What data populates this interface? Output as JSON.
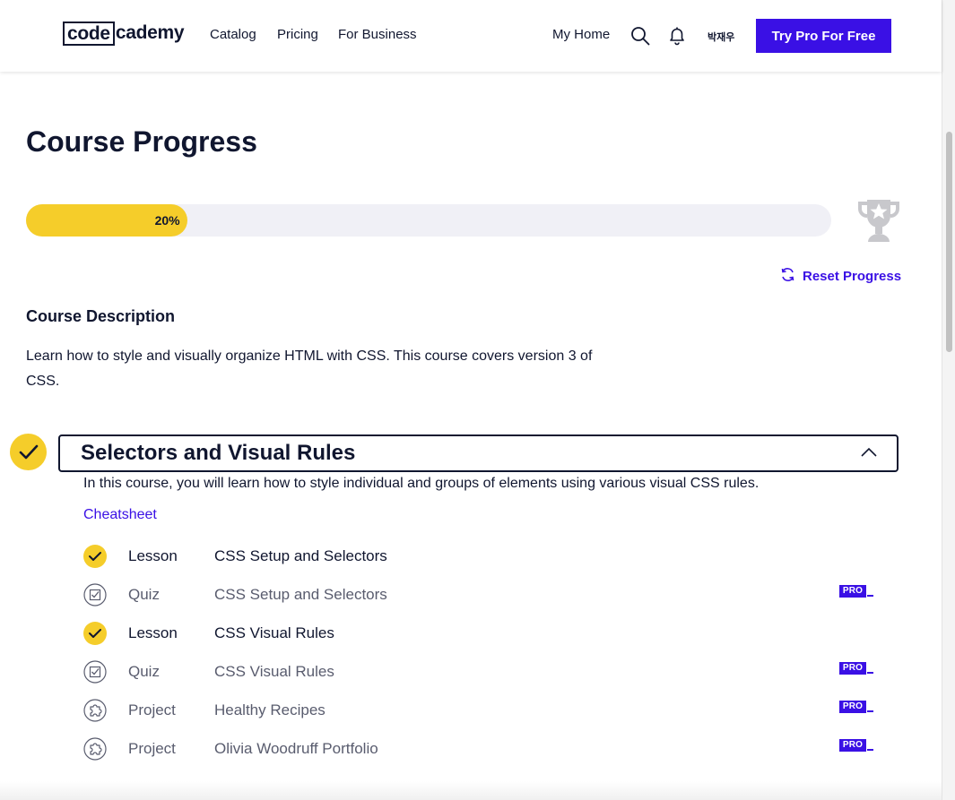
{
  "header": {
    "logo_box_text": "code",
    "logo_rest_text": "cademy",
    "nav": [
      "Catalog",
      "Pricing",
      "For Business"
    ],
    "my_home": "My Home",
    "user_name": "박재우",
    "cta_label": "Try Pro For Free"
  },
  "page": {
    "title": "Course Progress",
    "progress_percent": 20,
    "progress_label": "20%",
    "reset_label": "Reset Progress",
    "description_heading": "Course Description",
    "description_text": "Learn how to style and visually organize HTML with CSS. This course covers version 3 of CSS."
  },
  "module": {
    "title": "Selectors and Visual Rules",
    "description": "In this course, you will learn how to style individual and groups of elements using various visual CSS rules.",
    "cheatsheet_label": "Cheatsheet",
    "pro_label": "PRO",
    "items": [
      {
        "type": "Lesson",
        "name": "CSS Setup and Selectors",
        "status": "completed",
        "icon": "checkmark-icon",
        "pro": false
      },
      {
        "type": "Quiz",
        "name": "CSS Setup and Selectors",
        "status": "not-started",
        "icon": "quiz-icon",
        "pro": true
      },
      {
        "type": "Lesson",
        "name": "CSS Visual Rules",
        "status": "completed",
        "icon": "checkmark-icon",
        "pro": false
      },
      {
        "type": "Quiz",
        "name": "CSS Visual Rules",
        "status": "not-started",
        "icon": "quiz-icon",
        "pro": true
      },
      {
        "type": "Project",
        "name": "Healthy Recipes",
        "status": "not-started",
        "icon": "puzzle-icon",
        "pro": true
      },
      {
        "type": "Project",
        "name": "Olivia Woodruff Portfolio",
        "status": "not-started",
        "icon": "puzzle-icon",
        "pro": true
      }
    ]
  },
  "colors": {
    "accent": "#3a10e5",
    "progress": "#f5cd2a",
    "text": "#10162f"
  }
}
